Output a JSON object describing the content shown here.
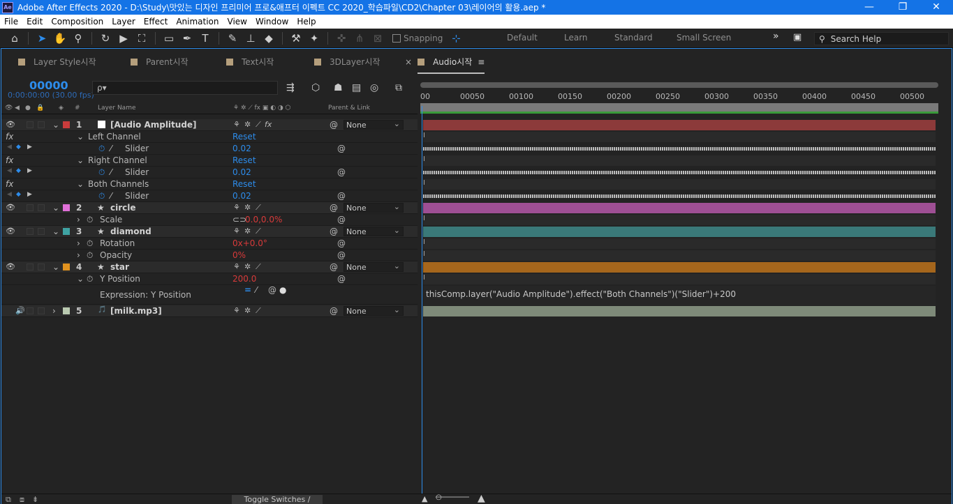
{
  "window": {
    "title": "Adobe After Effects 2020 - D:\\Study\\맛있는 디자인 프리미어 프로&애프터 이펙트 CC 2020_학습파일\\CD2\\Chapter 03\\레이어의 활용.aep *",
    "app_icon": "Ae",
    "min": "—",
    "restore": "❐",
    "close": "✕"
  },
  "menu": [
    "File",
    "Edit",
    "Composition",
    "Layer",
    "Effect",
    "Animation",
    "View",
    "Window",
    "Help"
  ],
  "toolbar": {
    "snapping": "Snapping",
    "workspaces": [
      "Default",
      "Learn",
      "Standard",
      "Small Screen"
    ],
    "more": "»",
    "search_help": "Search Help"
  },
  "tabs": [
    {
      "label": "Layer Style시작"
    },
    {
      "label": "Parent시작"
    },
    {
      "label": "Text시작"
    },
    {
      "label": "3DLayer시작"
    },
    {
      "label": "Audio시작",
      "active": true
    }
  ],
  "comp": {
    "timecode": "00000",
    "timecode_sub": "0:00:00:00 (30.00 fps)",
    "search_placeholder": "ρ▾"
  },
  "columns": {
    "hash": "#",
    "layer_name": "Layer Name",
    "parent_link": "Parent & Link"
  },
  "rows": [
    {
      "type": "layer",
      "num": "1",
      "name": "[Audio Amplitude]",
      "color": "#c83c3c",
      "parent": "None"
    },
    {
      "type": "effect",
      "name": "Left Channel",
      "value": "Reset"
    },
    {
      "type": "prop",
      "name": "Slider",
      "value": "0.02"
    },
    {
      "type": "effect",
      "name": "Right Channel",
      "value": "Reset"
    },
    {
      "type": "prop",
      "name": "Slider",
      "value": "0.02"
    },
    {
      "type": "effect",
      "name": "Both Channels",
      "value": "Reset"
    },
    {
      "type": "prop",
      "name": "Slider",
      "value": "0.02"
    },
    {
      "type": "layer",
      "num": "2",
      "name": "circle",
      "color": "#e070d8",
      "parent": "None"
    },
    {
      "type": "prop",
      "name": "Scale",
      "value": "0.0,0.0%"
    },
    {
      "type": "layer",
      "num": "3",
      "name": "diamond",
      "color": "#3fa3a3",
      "parent": "None"
    },
    {
      "type": "prop",
      "name": "Rotation",
      "value": "0x+0.0°"
    },
    {
      "type": "prop",
      "name": "Opacity",
      "value": "0%"
    },
    {
      "type": "layer",
      "num": "4",
      "name": "star",
      "color": "#e0921f",
      "parent": "None"
    },
    {
      "type": "prop",
      "name": "Y Position",
      "value": "200.0"
    },
    {
      "type": "expression",
      "name": "Expression: Y Position"
    },
    {
      "type": "layer",
      "num": "5",
      "name": "[milk.mp3]",
      "color": "#b9c9b0",
      "parent": "None"
    }
  ],
  "timeline": {
    "ticks": [
      "00",
      "00050",
      "00100",
      "00150",
      "00200",
      "00250",
      "00300",
      "00350",
      "00400",
      "00450",
      "00500"
    ],
    "expression_text": "thisComp.layer(\"Audio Amplitude\").effect(\"Both Channels\")(\"Slider\")+200",
    "bar_colors": {
      "audio_amplitude": "#8c3a3a",
      "circle": "#9e4f94",
      "diamond": "#3a7979",
      "star": "#a5661c",
      "milk": "#7e8a79"
    }
  },
  "bottom": {
    "toggle": "Toggle Switches / Modes"
  }
}
